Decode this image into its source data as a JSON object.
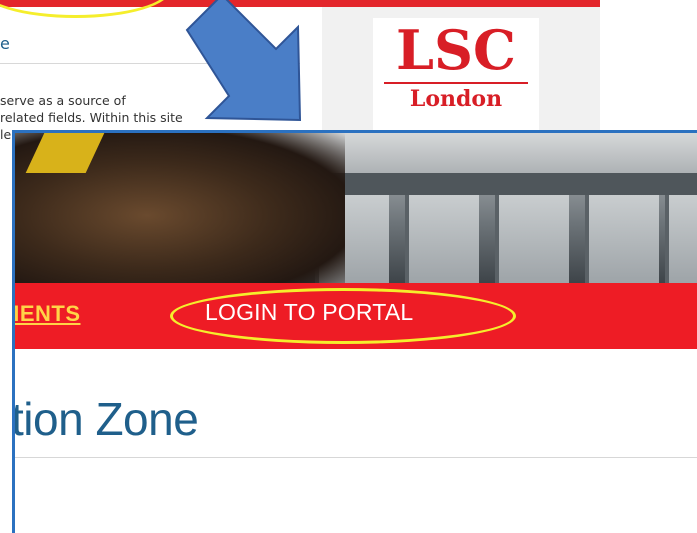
{
  "background_page": {
    "heading_fragment": "e",
    "body_lines": [
      "serve as a source of",
      "related fields. Within this site",
      "le"
    ],
    "logo": {
      "top": "LSC",
      "bottom": "London"
    }
  },
  "overlay_page": {
    "nav": {
      "partial_item": "MENTS",
      "login_item": "LOGIN TO PORTAL"
    },
    "zone_heading": "tion Zone"
  },
  "colors": {
    "nav_red": "#ee1c25",
    "highlight": "#f5ee2c",
    "arrow": "#4a7ec7",
    "heading_blue": "#1f5f8b",
    "logo_red": "#d81e26"
  }
}
